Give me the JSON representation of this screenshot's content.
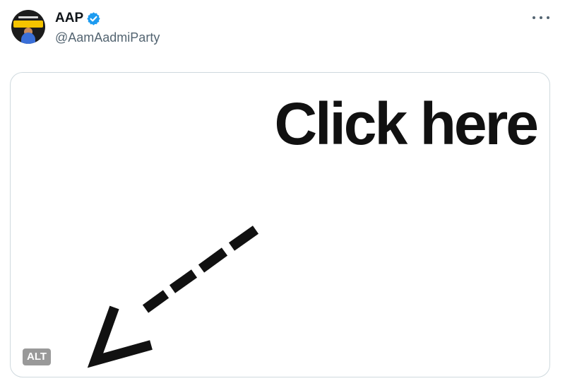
{
  "post": {
    "display_name": "AAP",
    "handle": "@AamAadmiParty",
    "verified_icon": "verified-badge-icon",
    "more_icon": "more-options-icon"
  },
  "media": {
    "image_text": "Click here",
    "alt_label": "ALT"
  },
  "colors": {
    "verified_blue": "#1d9bf0",
    "handle_gray": "#536471",
    "border": "#cfd9de"
  }
}
